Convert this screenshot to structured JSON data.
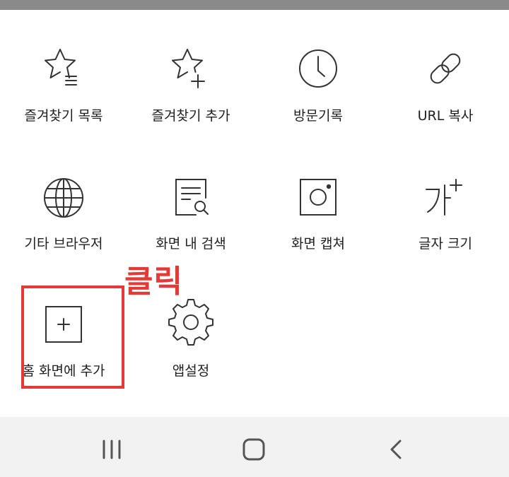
{
  "menu": {
    "items": [
      {
        "label": "즐겨찾기 목록",
        "icon": "star-list-icon"
      },
      {
        "label": "즐겨찾기 추가",
        "icon": "star-plus-icon"
      },
      {
        "label": "방문기록",
        "icon": "clock-icon"
      },
      {
        "label": "URL 복사",
        "icon": "link-icon"
      },
      {
        "label": "기타 브라우저",
        "icon": "globe-icon"
      },
      {
        "label": "화면 내 검색",
        "icon": "page-search-icon"
      },
      {
        "label": "화면 캡쳐",
        "icon": "camera-capture-icon"
      },
      {
        "label": "글자 크기",
        "icon": "text-size-icon"
      },
      {
        "label": "홈 화면에 추가",
        "icon": "add-square-icon"
      },
      {
        "label": "앱설정",
        "icon": "gear-icon"
      }
    ]
  },
  "annotation": {
    "text": "클릭",
    "color": "#e53935"
  },
  "navbar": {
    "recent": "recent-apps-icon",
    "home": "home-icon",
    "back": "back-icon"
  },
  "colors": {
    "icon_stroke": "#333333",
    "background": "#ffffff",
    "navbar_bg": "#f2f2f2",
    "top_strip": "#8a8a8a"
  }
}
